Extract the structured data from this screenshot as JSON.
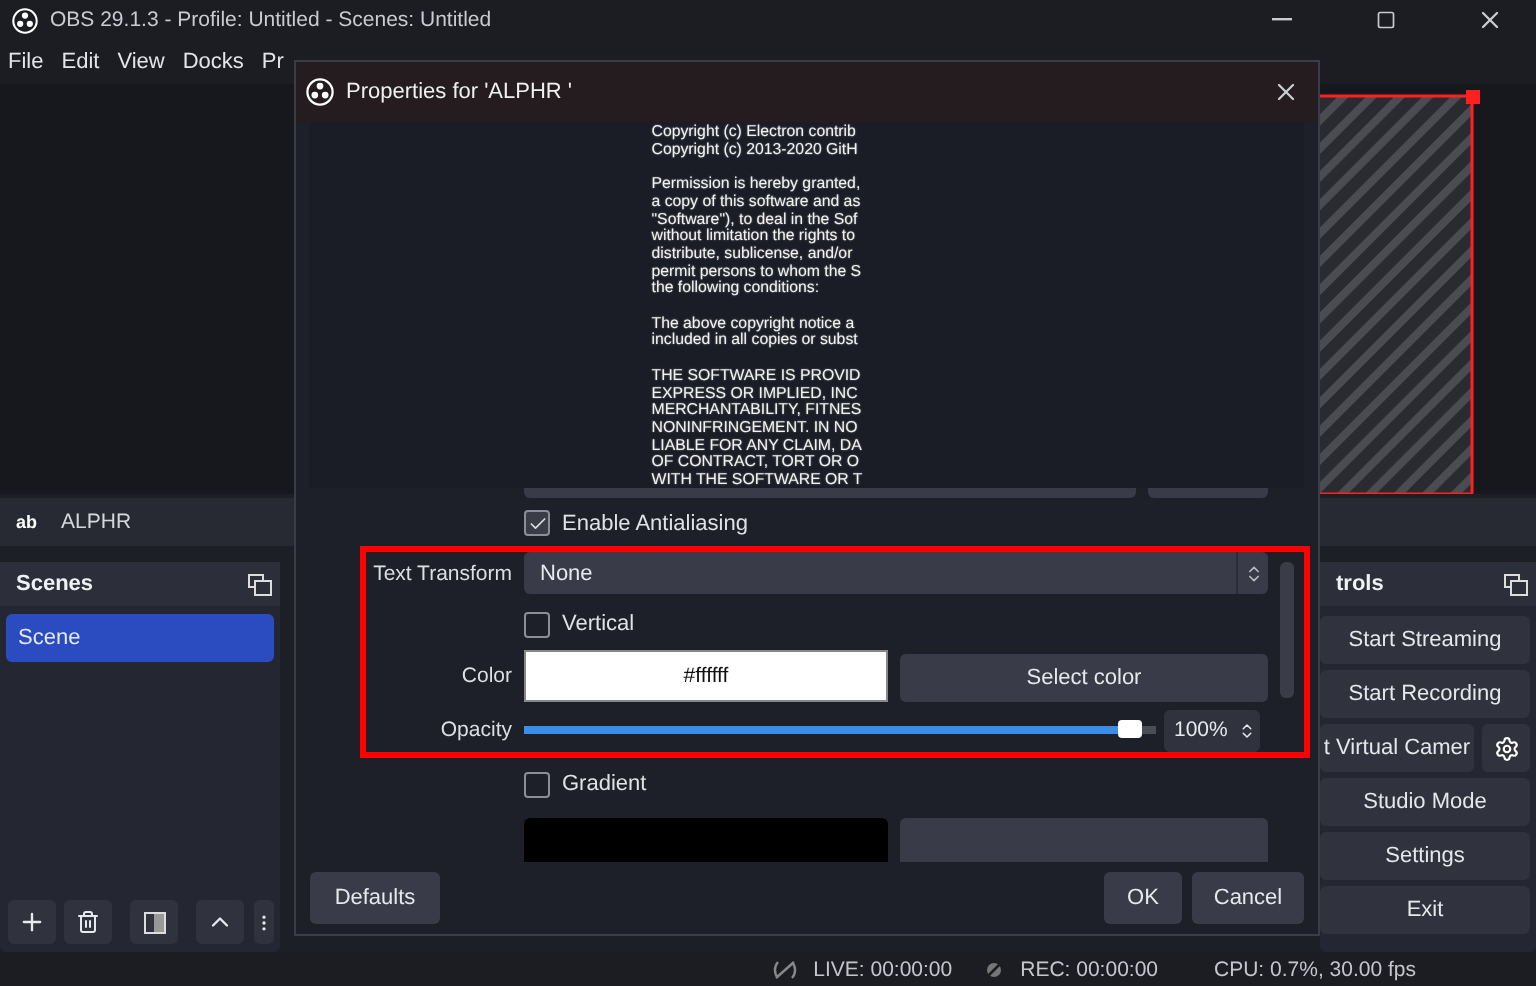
{
  "window": {
    "title": "OBS 29.1.3 - Profile: Untitled - Scenes: Untitled"
  },
  "menu": [
    "File",
    "Edit",
    "View",
    "Docks",
    "Pr"
  ],
  "source_bar": {
    "icon_text": "ab",
    "name": "ALPHR"
  },
  "scenes_dock": {
    "title": "Scenes",
    "items": [
      {
        "label": "Scene",
        "selected": true
      }
    ]
  },
  "controls_dock": {
    "title": "trols",
    "buttons": [
      {
        "label": "Start Streaming",
        "kind": "plain"
      },
      {
        "label": "Start Recording",
        "kind": "plain"
      },
      {
        "label": "t Virtual Camer",
        "kind": "with_gear"
      },
      {
        "label": "Studio Mode",
        "kind": "plain"
      },
      {
        "label": "Settings",
        "kind": "plain"
      },
      {
        "label": "Exit",
        "kind": "plain"
      }
    ]
  },
  "status_bar": {
    "live": "LIVE: 00:00:00",
    "rec": "REC: 00:00:00",
    "cpu": "CPU: 0.7%, 30.00 fps"
  },
  "dialog": {
    "title": "Properties for 'ALPHR '",
    "preview_text": [
      [
        "Copyright (c) Electron contrib",
        "Copyright (c) 2013-2020 GitH"
      ],
      [
        "Permission is hereby granted,",
        "a copy of this software and as",
        "\"Software\"), to deal in the Sof",
        "without limitation the rights to",
        "distribute, sublicense, and/or",
        "permit persons to whom the S",
        "the following conditions:"
      ],
      [
        "The above copyright notice a",
        "included in all copies or subst"
      ],
      [
        "THE SOFTWARE IS PROVID",
        "EXPRESS OR IMPLIED, INC",
        "MERCHANTABILITY, FITNES",
        "NONINFRINGEMENT. IN NO",
        "LIABLE FOR ANY CLAIM, DA",
        "OF CONTRACT, TORT OR O",
        "WITH THE SOFTWARE OR T"
      ]
    ],
    "properties": [
      {
        "kind": "partial_top"
      },
      {
        "kind": "checkbox",
        "label": "Enable Antialiasing",
        "checked": true
      },
      {
        "kind": "select",
        "label": "Text Transform",
        "value": "None"
      },
      {
        "kind": "checkbox",
        "label": "Vertical",
        "checked": false
      },
      {
        "kind": "color",
        "label": "Color",
        "value": "#ffffff",
        "button": "Select color"
      },
      {
        "kind": "slider",
        "label": "Opacity",
        "level": 0.96,
        "reading": "100%"
      },
      {
        "kind": "checkbox",
        "label": "Gradient",
        "checked": false
      },
      {
        "kind": "partial_bottom"
      }
    ],
    "buttons": {
      "defaults": "Defaults",
      "ok": "OK",
      "cancel": "Cancel"
    }
  }
}
